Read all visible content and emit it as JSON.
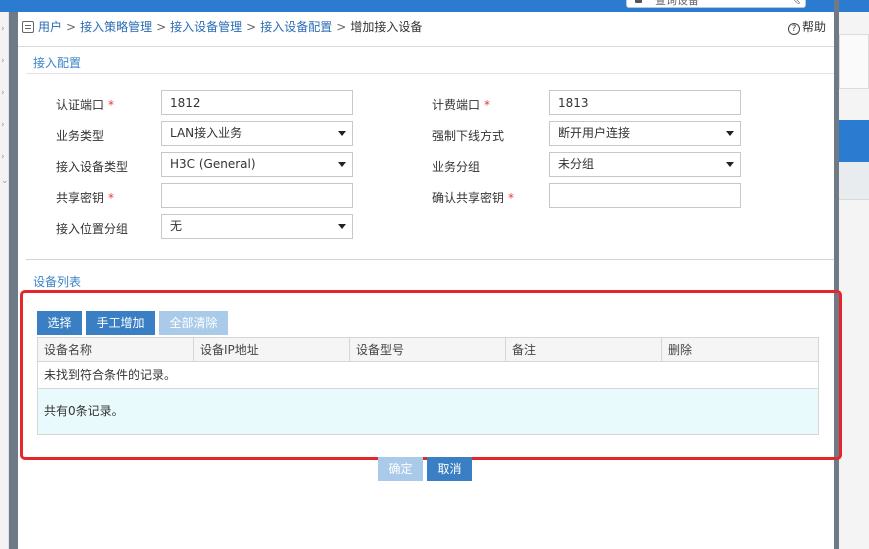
{
  "search": {
    "hint": "查询设备"
  },
  "breadcrumb": {
    "items": [
      "用户",
      "接入策略管理",
      "接入设备管理",
      "接入设备配置"
    ],
    "current": "增加接入设备",
    "separator": ">"
  },
  "help": {
    "label": "帮助",
    "icon": "?"
  },
  "access_config": {
    "title": "接入配置",
    "auth_port": {
      "label": "认证端口",
      "required": "*",
      "value": "1812"
    },
    "acct_port": {
      "label": "计费端口",
      "required": "*",
      "value": "1813"
    },
    "service_type": {
      "label": "业务类型",
      "value": "LAN接入业务"
    },
    "force_offline": {
      "label": "强制下线方式",
      "value": "断开用户连接"
    },
    "device_type": {
      "label": "接入设备类型",
      "value": "H3C (General)"
    },
    "service_group": {
      "label": "业务分组",
      "value": "未分组"
    },
    "shared_key": {
      "label": "共享密钥",
      "required": "*",
      "value": ""
    },
    "confirm_key": {
      "label": "确认共享密钥",
      "required": "*",
      "value": ""
    },
    "location_group": {
      "label": "接入位置分组",
      "value": "无"
    }
  },
  "device_list": {
    "title": "设备列表",
    "buttons": {
      "select": "选择",
      "manual_add": "手工增加",
      "clear_all": "全部清除"
    },
    "columns": [
      "设备名称",
      "设备IP地址",
      "设备型号",
      "备注",
      "删除"
    ],
    "empty_text": "未找到符合条件的记录。",
    "summary": "共有0条记录。"
  },
  "footer": {
    "ok": "确定",
    "cancel": "取消"
  },
  "colors": {
    "accent": "#3a7fc4",
    "highlight": "#e5262a",
    "top_bar": "#2b7bd0"
  }
}
